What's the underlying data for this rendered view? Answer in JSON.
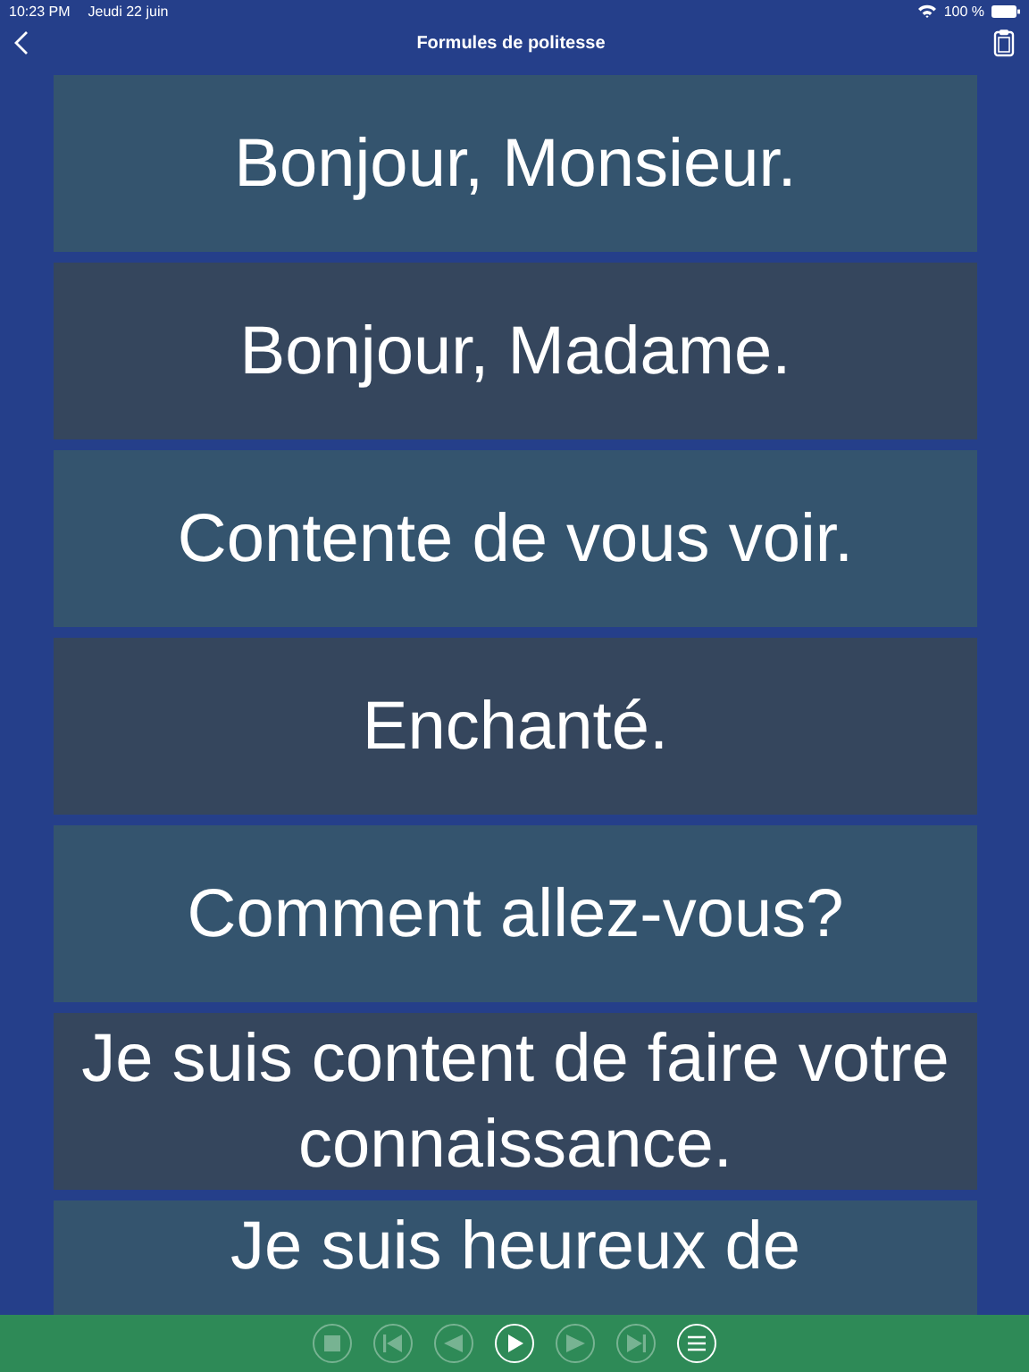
{
  "status_bar": {
    "time": "10:23 PM",
    "date": "Jeudi 22 juin",
    "battery": "100 %"
  },
  "nav": {
    "title": "Formules de politesse"
  },
  "phrases": [
    {
      "text": "Bonjour, Monsieur."
    },
    {
      "text": "Bonjour, Madame."
    },
    {
      "text": "Contente de vous voir."
    },
    {
      "text": "Enchanté."
    },
    {
      "text": "Comment allez-vous?"
    },
    {
      "text": "Je suis content de faire votre connaissance."
    },
    {
      "text": "Je suis heureux de"
    }
  ],
  "player_controls": [
    {
      "kind": "stop",
      "disabled": true
    },
    {
      "kind": "first",
      "disabled": true
    },
    {
      "kind": "previous",
      "disabled": true
    },
    {
      "kind": "play",
      "disabled": false
    },
    {
      "kind": "next",
      "disabled": true
    },
    {
      "kind": "last",
      "disabled": true
    },
    {
      "kind": "menu",
      "disabled": false
    }
  ]
}
